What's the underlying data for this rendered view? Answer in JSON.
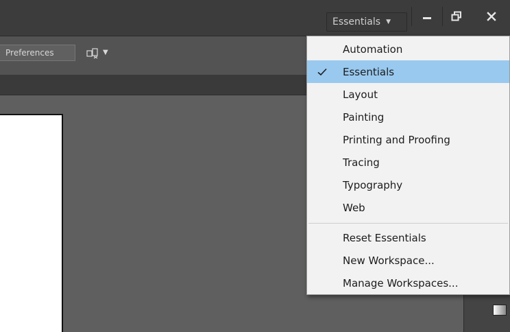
{
  "titlebar": {
    "workspace_switcher": {
      "label": "Essentials"
    }
  },
  "controlbar": {
    "preferences_label": "Preferences"
  },
  "workspace_menu": {
    "items": [
      {
        "label": "Automation",
        "checked": false
      },
      {
        "label": "Essentials",
        "checked": true
      },
      {
        "label": "Layout",
        "checked": false
      },
      {
        "label": "Painting",
        "checked": false
      },
      {
        "label": "Printing and Proofing",
        "checked": false
      },
      {
        "label": "Tracing",
        "checked": false
      },
      {
        "label": "Typography",
        "checked": false
      },
      {
        "label": "Web",
        "checked": false
      }
    ],
    "actions": [
      {
        "label": "Reset Essentials"
      },
      {
        "label": "New Workspace..."
      },
      {
        "label": "Manage Workspaces..."
      }
    ]
  },
  "colors": {
    "titlebar_bg": "#3c3c3c",
    "menu_bg": "#f2f2f2",
    "menu_selected": "#99c9ef",
    "canvas_bg": "#5e5f5e"
  }
}
